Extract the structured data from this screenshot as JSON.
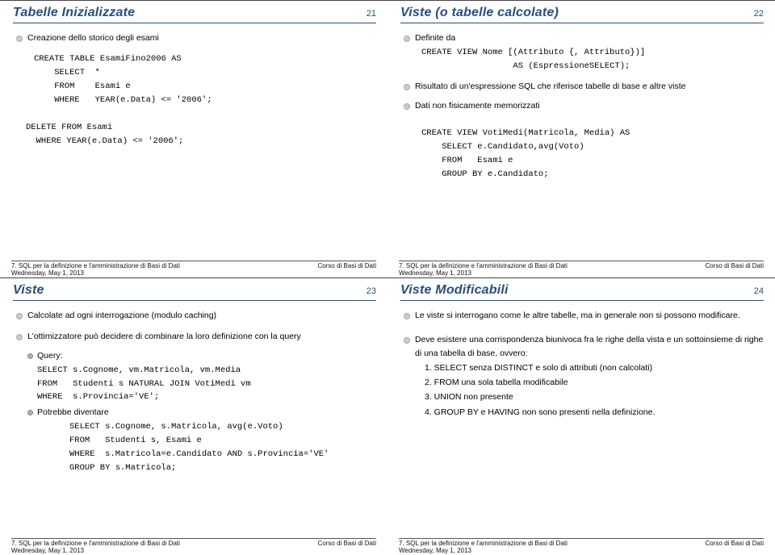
{
  "slides": {
    "s21": {
      "title": "Tabelle Inizializzate",
      "num": "21",
      "b1": "Creazione dello storico degli esami",
      "code1": "CREATE TABLE EsamiFino2006 AS\n    SELECT  *\n    FROM    Esami e\n    WHERE   YEAR(e.Data) <= '2006';",
      "code2": "DELETE FROM Esami\n  WHERE YEAR(e.Data) <= '2006';"
    },
    "s22": {
      "title": "Viste (o tabelle calcolate)",
      "num": "22",
      "b1": "Definite da",
      "code1": "CREATE VIEW Nome [(Attributo {, Attributo})]\n                  AS (EspressioneSELECT);",
      "b2": "Risultato di un'espressione SQL che riferisce tabelle di base e altre viste",
      "b3": "Dati non fisicamente memorizzati",
      "code2": "CREATE VIEW VotiMedi(Matricola, Media) AS\n    SELECT e.Candidato,avg(Voto)\n    FROM   Esami e\n    GROUP BY e.Candidato;"
    },
    "s23": {
      "title": "Viste",
      "num": "23",
      "b1": "Calcolate ad ogni interrogazione (modulo caching)",
      "b2": "L'ottimizzatore può decidere di combinare la loro definizione con la query",
      "b3": "Query:",
      "code1": "SELECT s.Cognome, vm.Matricola, vm.Media\nFROM   Studenti s NATURAL JOIN VotiMedi vm\nWHERE  s.Provincia='VE';",
      "b4": "Potrebbe diventare",
      "code2": "SELECT s.Cognome, s.Matricola, avg(e.Voto)\nFROM   Studenti s, Esami e\nWHERE  s.Matricola=e.Candidato AND s.Provincia='VE'\nGROUP BY s.Matricola;"
    },
    "s24": {
      "title": "Viste Modificabili",
      "num": "24",
      "b1": "Le viste si interrogano come le altre tabelle, ma in generale non  si possono modificare.",
      "b2": "Deve esistere una corrispondenza biunivoca fra le righe della vista e un sottoinsieme di righe di una tabella di base, ovvero:",
      "n1": "1. SELECT senza DISTINCT e solo di attributi (non calcolati)",
      "n2": "2. FROM una sola tabella modificabile",
      "n3": "3. UNION non presente",
      "n4": "4. GROUP BY e HAVING non sono presenti nella definizione."
    }
  },
  "footer": {
    "left": "7. SQL per la definizione e l'amministrazione di Basi di Dati",
    "right": "Corso di Basi di Dati",
    "date": "Wednesday, May 1, 2013"
  }
}
